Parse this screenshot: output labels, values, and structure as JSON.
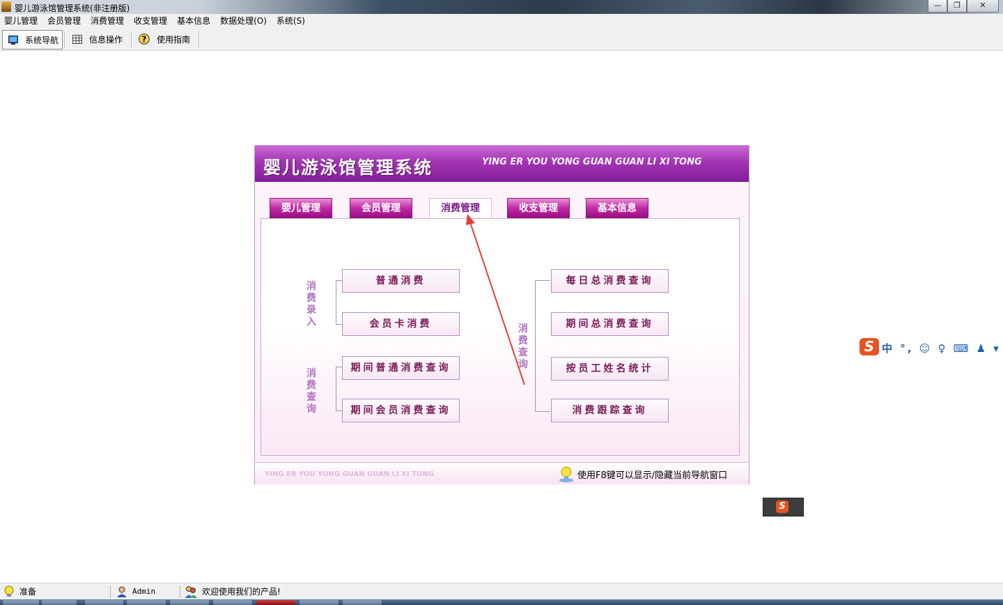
{
  "window": {
    "title": "婴儿游泳馆管理系统(非注册版)",
    "controls": [
      "minimize",
      "maximize",
      "close"
    ]
  },
  "menu": [
    "婴儿管理",
    "会员管理",
    "消费管理",
    "收支管理",
    "基本信息",
    "数据处理(O)",
    "系统(S)"
  ],
  "toolbar": [
    {
      "label": "系统导航",
      "icon": "monitor-icon",
      "active": true
    },
    {
      "label": "信息操作",
      "icon": "grid-icon",
      "active": false
    },
    {
      "label": "使用指南",
      "icon": "help-icon",
      "active": false
    }
  ],
  "panel": {
    "title_cn": "婴儿游泳馆管理系统",
    "title_en": "YING ER YOU YONG GUAN GUAN LI XI TONG",
    "tabs": [
      {
        "label": "婴儿管理",
        "selected": false
      },
      {
        "label": "会员管理",
        "selected": false
      },
      {
        "label": "消费管理",
        "selected": true
      },
      {
        "label": "收支管理",
        "selected": false
      },
      {
        "label": "基本信息",
        "selected": false
      }
    ],
    "groups": {
      "entry_label": "消费录入",
      "query_label": "消费查询",
      "right_label": "消费查询"
    },
    "left_buttons": [
      "普通消费",
      "会员卡消费",
      "期间普通消费查询",
      "期间会员消费查询"
    ],
    "right_buttons": [
      "每日总消费查询",
      "期间总消费查询",
      "按员工姓名统计",
      "消费跟踪查询"
    ],
    "footer_en": "YING ER YOU YONG GUAN GUAN LI XI TONG",
    "footer_hint": "使用F8键可以显示/隐藏当前导航窗口"
  },
  "ime": {
    "brand_letter": "S",
    "toolbar_text": "中 °, ☺ ♀ ⌨ ♟ ▾ ▦"
  },
  "status": {
    "state": "准备",
    "user": "Admin",
    "message": "欢迎使用我们的产品!"
  },
  "colors": {
    "accent": "#a135b3",
    "button_text": "#7a1b57",
    "group_label": "#b075c0",
    "annotation_arrow": "#e0413a"
  }
}
